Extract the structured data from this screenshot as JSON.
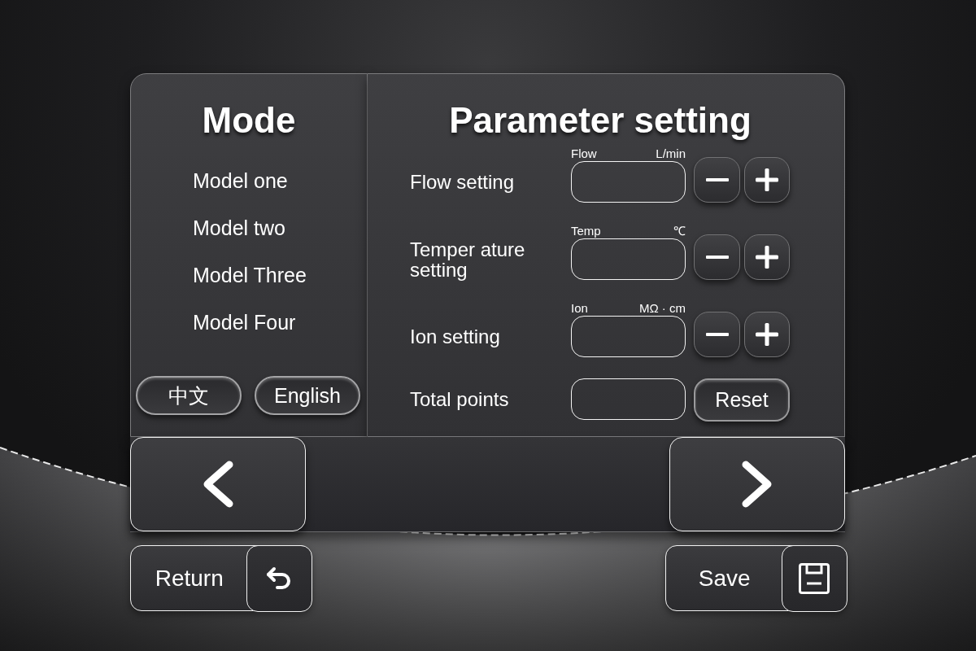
{
  "mode_panel": {
    "title": "Mode",
    "items": [
      "Model one",
      "Model two",
      "Model Three",
      "Model Four"
    ],
    "language_buttons": [
      "中文",
      "English"
    ]
  },
  "parameter_panel": {
    "title": "Parameter setting",
    "rows": [
      {
        "kind": "stepper",
        "label": "Flow setting",
        "field_caption": "Flow",
        "unit": "L/min"
      },
      {
        "kind": "stepper",
        "label": "Temper ature setting",
        "field_caption": "Temp",
        "unit": "℃"
      },
      {
        "kind": "stepper",
        "label": "Ion setting",
        "field_caption": "Ion",
        "unit": "MΩ · cm"
      },
      {
        "kind": "reset",
        "label": "Total points",
        "button": "Reset"
      }
    ]
  },
  "footer_buttons": [
    {
      "kind": "return",
      "label": "Return"
    },
    {
      "kind": "save",
      "label": "Save"
    }
  ]
}
